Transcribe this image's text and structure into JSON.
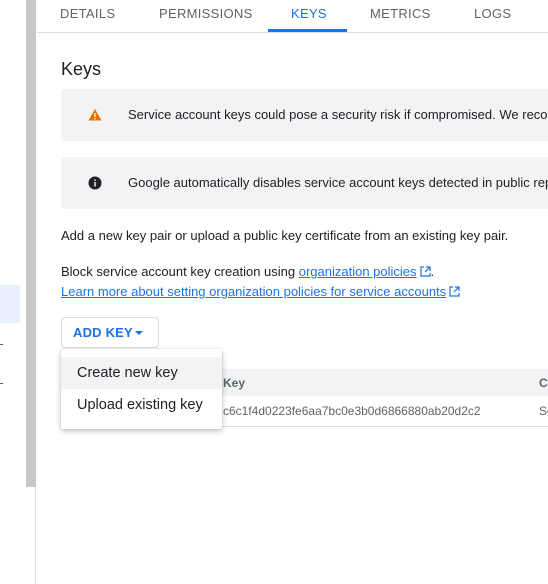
{
  "tabs": [
    {
      "label": "DETAILS",
      "active": false
    },
    {
      "label": "PERMISSIONS",
      "active": false
    },
    {
      "label": "KEYS",
      "active": true
    },
    {
      "label": "METRICS",
      "active": false
    },
    {
      "label": "LOGS",
      "active": false
    }
  ],
  "section_title": "Keys",
  "banners": {
    "warning": {
      "icon": "warning-icon",
      "color": "#e37400",
      "text": "Service account keys could pose a security risk if compromised. We recom"
    },
    "info": {
      "icon": "info-icon",
      "color": "#202124",
      "text": "Google automatically disables service account keys detected in public rep"
    }
  },
  "intro_text": "Add a new key pair or upload a public key certificate from an existing key pair.",
  "policy": {
    "prefix": "Block service account key creation using ",
    "link_label": "organization policies",
    "suffix": ".",
    "learn_more_label": "Learn more about setting organization policies for service accounts"
  },
  "add_key": {
    "label": "ADD KEY",
    "icon": "chevron-down-icon"
  },
  "dropdown_menu": {
    "items": [
      {
        "label": "Create new key",
        "hovered": true
      },
      {
        "label": "Upload existing key",
        "hovered": false
      }
    ]
  },
  "keys_table": {
    "columns": [
      "Key",
      "Cr"
    ],
    "rows": [
      {
        "key": "c6c1f4d0223fe6aa7bc0e3b0d6866880ab20d2c2",
        "created": "Se"
      }
    ]
  },
  "colors": {
    "accent": "#1a73e8",
    "banner_bg": "#f1f3f4",
    "warning": "#e37400"
  }
}
